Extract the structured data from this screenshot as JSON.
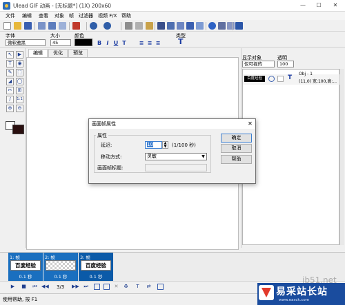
{
  "window": {
    "title": "Ulead GIF 动画 - [无标题*] (1X) 200x60",
    "min": "—",
    "max": "☐",
    "close": "✕"
  },
  "menu": [
    "文件",
    "编辑",
    "查看",
    "对象",
    "帧",
    "过滤器",
    "视频 F/X",
    "帮助"
  ],
  "props": {
    "font_label": "字体",
    "font_value": "微软雅黑",
    "size_label": "大小",
    "size_value": "45",
    "color_label": "颜色",
    "color_value": "#000000",
    "type_label": "类型",
    "format_buttons": [
      "B",
      "I",
      "U",
      "T",
      "≡",
      "≡",
      "≡"
    ]
  },
  "tools": [
    "↖",
    "▶",
    "T",
    "◉",
    "✎",
    "⬚",
    "◢",
    "◯",
    "✂",
    "⊞",
    "∕",
    "1:1",
    "⊕",
    "⊖"
  ],
  "tabs": [
    {
      "label": "编辑",
      "active": true
    },
    {
      "label": "优化",
      "active": false
    },
    {
      "label": "预览",
      "active": false
    }
  ],
  "objects": {
    "show_label": "显示对象",
    "show_value": "仅可视的",
    "opacity_label": "透明",
    "opacity_value": "100",
    "item_name": "Obj - 1",
    "item_detail": "(11,0) 宽:100,高:...",
    "item_thumb": "百度经验"
  },
  "frames": [
    {
      "num": "1: 帧",
      "thumb": "百度经验",
      "delay": "0.1 秒",
      "transparent": false
    },
    {
      "num": "2: 帧",
      "thumb": "",
      "delay": "0.1 秒",
      "transparent": true
    },
    {
      "num": "3: 帧",
      "thumb": "百度经验",
      "delay": "0.1 秒",
      "transparent": false
    }
  ],
  "playback": {
    "counter": "3/3"
  },
  "status": "使用帮助, 按 F1",
  "dialog": {
    "title": "画面帧属性",
    "close": "✕",
    "group": "属性",
    "delay_label": "延迟:",
    "delay_value": "10",
    "delay_unit": "(1/100 秒)",
    "move_label": "移动方式:",
    "move_value": "灵敏",
    "frame_title_label": "画面帧标题:",
    "frame_title_value": "",
    "ok": "确定",
    "cancel": "取消",
    "help": "帮助"
  },
  "watermark": {
    "site": "jb51.net",
    "name": "易采站长站",
    "url": "www.easck.com"
  }
}
